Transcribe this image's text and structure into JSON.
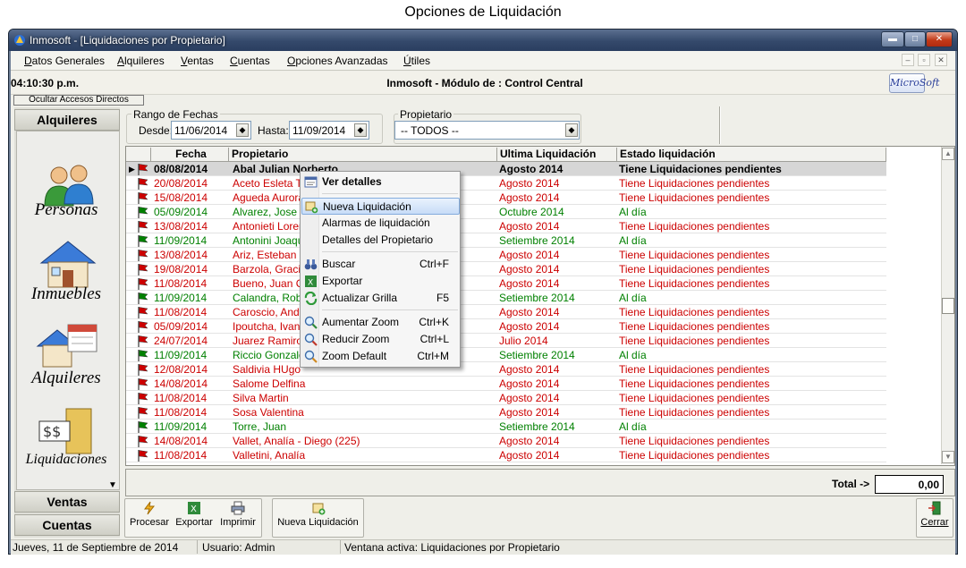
{
  "caption": "Opciones de Liquidación",
  "window": {
    "title": "Inmosoft - [Liquidaciones por Propietario]",
    "min": "▬",
    "max": "□",
    "close": "✕"
  },
  "menu": [
    {
      "label": "Datos Generales",
      "key": "D",
      "rest": "atos Generales"
    },
    {
      "label": "Alquileres",
      "key": "A",
      "rest": "lquileres"
    },
    {
      "label": "Ventas",
      "key": "V",
      "rest": "entas"
    },
    {
      "label": "Cuentas",
      "key": "C",
      "rest": "uentas"
    },
    {
      "label": "Opciones Avanzadas",
      "key": "O",
      "rest": "pciones Avanzadas"
    },
    {
      "label": "Útiles",
      "key": "Ú",
      "rest": "tiles"
    }
  ],
  "mdi": {
    "min": "–",
    "restore": "▫",
    "close": "✕"
  },
  "header": {
    "clock": "04:10:30 p.m.",
    "module": "Inmosoft - Módulo de : Control Central",
    "logo": "MicroSoft"
  },
  "ocultar": "Ocultar Accesos Directos",
  "nav": {
    "alquileres_header": "Alquileres",
    "items": [
      "Personas",
      "Inmuebles",
      "Alquileres",
      "Liquidaciones"
    ],
    "ventas": "Ventas",
    "cuentas": "Cuentas"
  },
  "filters": {
    "rango_legend": "Rango de Fechas",
    "desde_label": "Desde:",
    "desde_value": "11/06/2014",
    "hasta_label": "Hasta:",
    "hasta_value": "11/09/2014",
    "prop_legend": "Propietario",
    "prop_value": "-- TODOS --"
  },
  "grid": {
    "headers": [
      "Fecha",
      "Propietario",
      "Ultima Liquidación",
      "Estado liquidación"
    ],
    "rows": [
      {
        "fecha": "08/08/2014",
        "prop": "Abal Julian Norberto",
        "ult": "Agosto 2014",
        "estado": "Tiene Liquidaciones pendientes",
        "status": "red",
        "selected": true
      },
      {
        "fecha": "20/08/2014",
        "prop": "Aceto Esleta Te",
        "ult": "Agosto 2014",
        "estado": "Tiene Liquidaciones pendientes",
        "status": "red"
      },
      {
        "fecha": "15/08/2014",
        "prop": "Agueda Aurora",
        "ult": "Agosto 2014",
        "estado": "Tiene Liquidaciones pendientes",
        "status": "red"
      },
      {
        "fecha": "05/09/2014",
        "prop": "Alvarez, Jose",
        "ult": "Octubre 2014",
        "estado": "Al día",
        "status": "green"
      },
      {
        "fecha": "13/08/2014",
        "prop": "Antonieti Loren",
        "ult": "Agosto 2014",
        "estado": "Tiene Liquidaciones pendientes",
        "status": "red"
      },
      {
        "fecha": "11/09/2014",
        "prop": "Antonini Joaquin",
        "ult": "Setiembre 2014",
        "estado": "Al día",
        "status": "green"
      },
      {
        "fecha": "13/08/2014",
        "prop": "Ariz, Esteban",
        "ult": "Agosto 2014",
        "estado": "Tiene Liquidaciones pendientes",
        "status": "red"
      },
      {
        "fecha": "19/08/2014",
        "prop": "Barzola, Graciel",
        "ult": "Agosto 2014",
        "estado": "Tiene Liquidaciones pendientes",
        "status": "red"
      },
      {
        "fecha": "11/08/2014",
        "prop": "Bueno, Juan Ca",
        "ult": "Agosto 2014",
        "estado": "Tiene Liquidaciones pendientes",
        "status": "red"
      },
      {
        "fecha": "11/09/2014",
        "prop": "Calandra, Robe",
        "ult": "Setiembre 2014",
        "estado": "Al día",
        "status": "green"
      },
      {
        "fecha": "11/08/2014",
        "prop": "Caroscio, Andre",
        "ult": "Agosto 2014",
        "estado": "Tiene Liquidaciones pendientes",
        "status": "red"
      },
      {
        "fecha": "05/09/2014",
        "prop": "Ipoutcha, Ivan",
        "ult": "Agosto 2014",
        "estado": "Tiene Liquidaciones pendientes",
        "status": "red"
      },
      {
        "fecha": "24/07/2014",
        "prop": "Juarez Ramiro",
        "ult": "Julio 2014",
        "estado": "Tiene Liquidaciones pendientes",
        "status": "red"
      },
      {
        "fecha": "11/09/2014",
        "prop": "Riccio Gonzalo",
        "ult": "Setiembre 2014",
        "estado": "Al día",
        "status": "green"
      },
      {
        "fecha": "12/08/2014",
        "prop": "Saldivia HUgo",
        "ult": "Agosto 2014",
        "estado": "Tiene Liquidaciones pendientes",
        "status": "red"
      },
      {
        "fecha": "14/08/2014",
        "prop": "Salome Delfina",
        "ult": "Agosto 2014",
        "estado": "Tiene Liquidaciones pendientes",
        "status": "red"
      },
      {
        "fecha": "11/08/2014",
        "prop": "Silva Martin",
        "ult": "Agosto 2014",
        "estado": "Tiene Liquidaciones pendientes",
        "status": "red"
      },
      {
        "fecha": "11/08/2014",
        "prop": "Sosa Valentina",
        "ult": "Agosto 2014",
        "estado": "Tiene Liquidaciones pendientes",
        "status": "red"
      },
      {
        "fecha": "11/09/2014",
        "prop": "Torre, Juan",
        "ult": "Setiembre 2014",
        "estado": "Al día",
        "status": "green"
      },
      {
        "fecha": "14/08/2014",
        "prop": "Vallet, Analía - Diego (225)",
        "ult": "Agosto 2014",
        "estado": "Tiene Liquidaciones pendientes",
        "status": "red"
      },
      {
        "fecha": "11/08/2014",
        "prop": "Valletini, Analía",
        "ult": "Agosto 2014",
        "estado": "Tiene Liquidaciones pendientes",
        "status": "red"
      }
    ]
  },
  "total": {
    "label": "Total ->",
    "value": "0,00"
  },
  "toolbar": {
    "procesar": "Procesar",
    "exportar": "Exportar",
    "imprimir": "Imprimir",
    "nueva": "Nueva Liquidación",
    "cerrar": "Cerrar"
  },
  "status": {
    "date": "Jueves, 11 de Septiembre de 2014",
    "user": "Usuario: Admin",
    "active": "Ventana activa: Liquidaciones por Propietario"
  },
  "context_menu": [
    {
      "label": "Ver detalles",
      "shortcut": "",
      "icon": "details-icon",
      "bold": true
    },
    {
      "label": "Nueva Liquidación",
      "shortcut": "",
      "icon": "new-liquidation-icon",
      "highlight": true
    },
    {
      "label": "Alarmas de liquidación",
      "shortcut": "",
      "icon": ""
    },
    {
      "label": "Detalles del Propietario",
      "shortcut": "",
      "icon": ""
    },
    {
      "label": "Buscar",
      "shortcut": "Ctrl+F",
      "icon": "binoculars-icon"
    },
    {
      "label": "Exportar",
      "shortcut": "",
      "icon": "excel-icon"
    },
    {
      "label": "Actualizar Grilla",
      "shortcut": "F5",
      "icon": "refresh-icon"
    },
    {
      "label": "Aumentar Zoom",
      "shortcut": "Ctrl+K",
      "icon": "zoom-in-icon"
    },
    {
      "label": "Reducir Zoom",
      "shortcut": "Ctrl+L",
      "icon": "zoom-out-icon"
    },
    {
      "label": "Zoom Default",
      "shortcut": "Ctrl+M",
      "icon": "zoom-default-icon"
    }
  ],
  "colors": {
    "red": "#cc0000",
    "green": "#008000",
    "title_bar": "#34496b",
    "highlight": "#c7dcf7"
  }
}
